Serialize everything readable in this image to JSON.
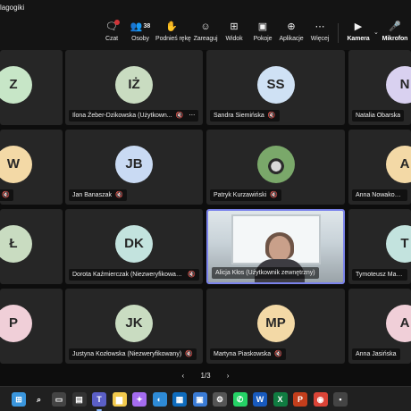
{
  "window": {
    "title": "lagogiki"
  },
  "toolbar": {
    "chat": {
      "label": "Czat",
      "icon": "chat-icon"
    },
    "people": {
      "label": "Osoby",
      "count": "38",
      "icon": "people-icon"
    },
    "raise_hand": {
      "label": "Podnieś rękę",
      "icon": "hand-icon"
    },
    "react": {
      "label": "Zareaguj",
      "icon": "smile-icon"
    },
    "view": {
      "label": "Widok",
      "icon": "grid-icon"
    },
    "rooms": {
      "label": "Pokoje",
      "icon": "rooms-icon"
    },
    "apps": {
      "label": "Aplikacje",
      "icon": "apps-icon"
    },
    "more": {
      "label": "Więcej",
      "icon": "more-icon"
    },
    "camera": {
      "label": "Kamera",
      "icon": "camera-icon"
    },
    "mic": {
      "label": "Mikrofon",
      "icon": "mic-off-icon"
    }
  },
  "participants": {
    "r0c0": {
      "initials": "Z",
      "name": "",
      "color": "#c7e6c7"
    },
    "r0c1": {
      "initials": "IŻ",
      "name": "Ilona Żeber-Dzikowska (Użytkown...",
      "color": "#c9dcc1"
    },
    "r0c2": {
      "initials": "SS",
      "name": "Sandra Siemińska",
      "color": "#cfe1f4"
    },
    "r0c3": {
      "initials": "N",
      "name": "Natalia Obarska",
      "color": "#d9d1f0"
    },
    "r1c0": {
      "initials": "W",
      "name": "",
      "color": "#f3d9a6"
    },
    "r1c1": {
      "initials": "JB",
      "name": "Jan Banaszak",
      "color": "#c9daf3"
    },
    "r1c2": {
      "initials": "",
      "name": "Patryk Kurzawiński",
      "color": "#7aa86a"
    },
    "r1c3": {
      "initials": "A",
      "name": "Anna Nowakowska",
      "color": "#f3d9a6"
    },
    "r2c0": {
      "initials": "Ł",
      "name": "",
      "color": "#c9dcc1"
    },
    "r2c1": {
      "initials": "DK",
      "name": "Dorota Kaźmierczak (Niezweryfikowan...",
      "color": "#c3e3de"
    },
    "r2c2": {
      "initials": "",
      "name": "Alicja Kłos (Użytkownik zewnętrzny)",
      "color": "#dfe6ea"
    },
    "r2c3": {
      "initials": "T",
      "name": "Tymoteusz Manuszak",
      "color": "#c3e3de"
    },
    "r3c0": {
      "initials": "P",
      "name": "",
      "color": "#f0cfd8"
    },
    "r3c1": {
      "initials": "JK",
      "name": "Justyna Kozłowska (Niezweryfikowany)",
      "color": "#c9dcc1"
    },
    "r3c2": {
      "initials": "MP",
      "name": "Martyna Piaskowska",
      "color": "#f3d9a6"
    },
    "r3c3": {
      "initials": "A",
      "name": "Anna Jasińska",
      "color": "#f0cfd8"
    }
  },
  "pager": {
    "prev": "‹",
    "label": "1/3",
    "next": "›"
  },
  "taskbar": {
    "apps": [
      {
        "icon": "windows-start-icon",
        "color": "#3a96dd"
      },
      {
        "icon": "search-icon",
        "color": "#202020"
      },
      {
        "icon": "task-view-icon",
        "color": "#444"
      },
      {
        "icon": "widgets-icon",
        "color": "#333"
      },
      {
        "icon": "teams-icon",
        "color": "#5b5fc7"
      },
      {
        "icon": "file-explorer-icon",
        "color": "#f2c94c"
      },
      {
        "icon": "copilot-icon",
        "color": "#a56cf0"
      },
      {
        "icon": "photos-icon",
        "color": "#2e8bd7"
      },
      {
        "icon": "calendar-icon",
        "color": "#0f6cbd"
      },
      {
        "icon": "ms-store-icon",
        "color": "#3a7bd5"
      },
      {
        "icon": "settings-icon",
        "color": "#555"
      },
      {
        "icon": "whatsapp-icon",
        "color": "#25d366"
      },
      {
        "icon": "word-icon",
        "color": "#185abd"
      },
      {
        "icon": "excel-icon",
        "color": "#107c41"
      },
      {
        "icon": "powerpoint-icon",
        "color": "#c43e1c"
      },
      {
        "icon": "chrome-icon",
        "color": "#db4437"
      },
      {
        "icon": "app-icon",
        "color": "#444"
      }
    ]
  }
}
